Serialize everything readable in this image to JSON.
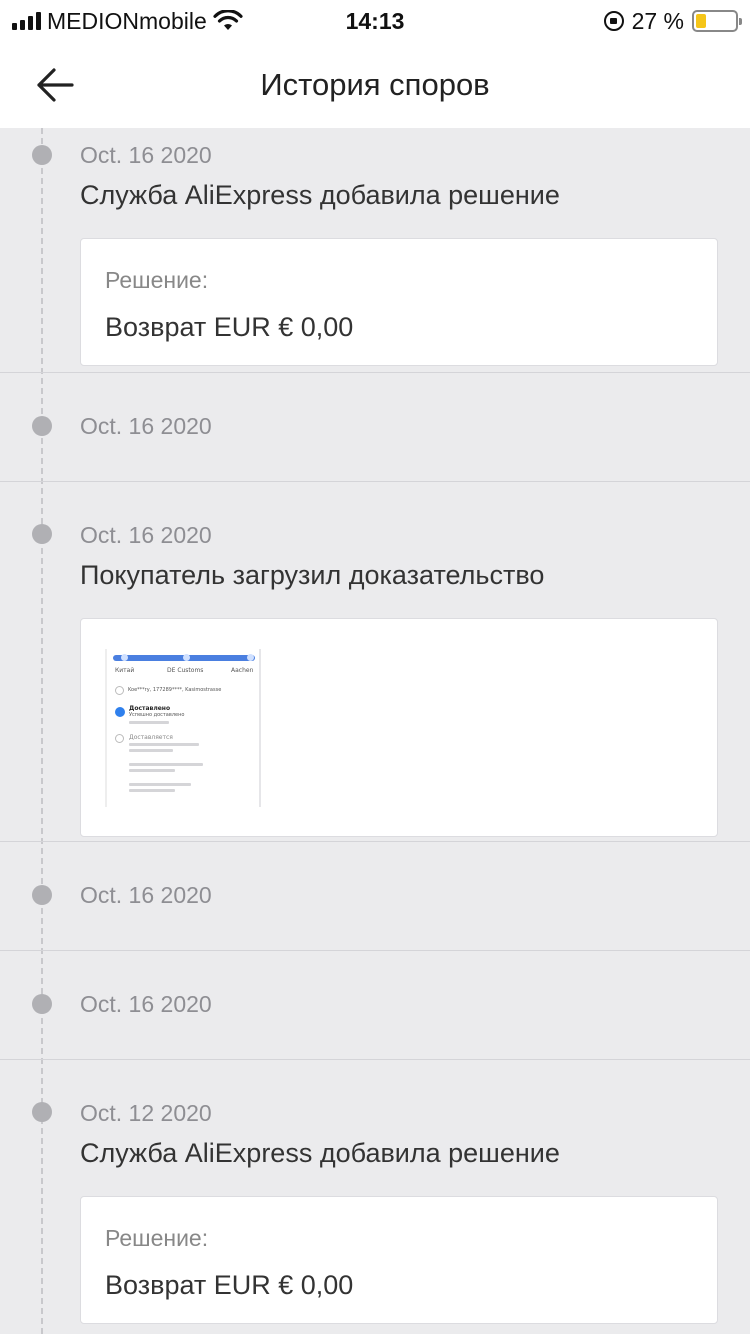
{
  "status_bar": {
    "carrier": "MEDIONmobile",
    "time": "14:13",
    "battery_percent": "27 %",
    "battery_level": 0.27
  },
  "header": {
    "title": "История споров",
    "back_icon": "arrow-left-icon"
  },
  "entries": [
    {
      "date": "Oct. 16 2020",
      "title": "Служба AliExpress добавила решение",
      "card": {
        "type": "resolution",
        "label": "Решение:",
        "value": "Возврат EUR € 0,00"
      }
    },
    {
      "date": "Oct. 16 2020"
    },
    {
      "date": "Oct. 16 2020",
      "title": "Покупатель загрузил доказательство",
      "card": {
        "type": "evidence",
        "thumb": {
          "tab_left": "Китай",
          "tab_mid": "DE Customs",
          "tab_right": "Aachen",
          "track_line": "Koe***ry, 177289****, Kasimostrasse",
          "status_done": "Доставлено",
          "status_done_sub": "Успешно доставлено",
          "status_transit": "Доставляется"
        }
      }
    },
    {
      "date": "Oct. 16 2020"
    },
    {
      "date": "Oct. 16 2020"
    },
    {
      "date": "Oct. 12 2020",
      "title": "Служба AliExpress добавила решение",
      "card": {
        "type": "resolution",
        "label": "Решение:",
        "value": "Возврат EUR € 0,00"
      }
    }
  ]
}
